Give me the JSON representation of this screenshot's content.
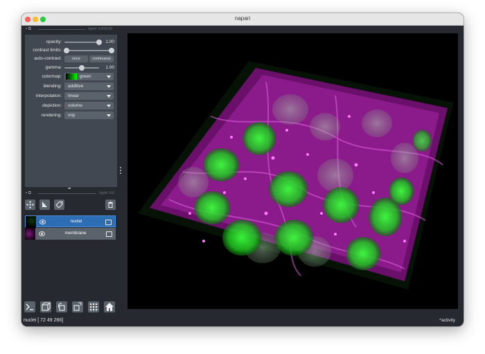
{
  "window": {
    "title": "napari"
  },
  "layer_controls": {
    "section_title": "layer controls",
    "opacity": {
      "label": "opacity:",
      "value": "1.00",
      "fraction": 1.0
    },
    "contrast_limits": {
      "label": "contrast limits:",
      "low_fraction": 0.0,
      "high_fraction": 1.0
    },
    "auto_contrast": {
      "label": "auto-contrast:",
      "once_label": "once",
      "continuous_label": "continuous"
    },
    "gamma": {
      "label": "gamma:",
      "value": "1.00",
      "fraction": 0.5
    },
    "colormap": {
      "label": "colormap:",
      "value": "green"
    },
    "blending": {
      "label": "blending:",
      "value": "additive"
    },
    "interpolation": {
      "label": "interpolation:",
      "value": "linear"
    },
    "depiction": {
      "label": "depiction:",
      "value": "volume"
    },
    "rendering": {
      "label": "rendering:",
      "value": "mip"
    }
  },
  "layer_list": {
    "section_title": "layer list",
    "layers": [
      {
        "name": "nuclei",
        "selected": true
      },
      {
        "name": "membrane",
        "selected": false
      }
    ]
  },
  "status_bar": {
    "text": "nuclei [ 72  49 266]",
    "activity_label": "activity"
  },
  "colors": {
    "accent": "#2d6db4",
    "panel": "#414851",
    "background": "#262930",
    "nuclei": "#00ff00",
    "membrane": "#ff00ff"
  }
}
